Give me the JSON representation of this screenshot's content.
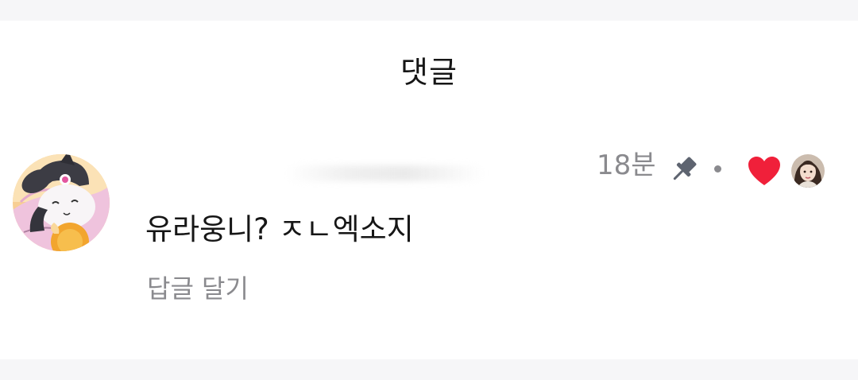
{
  "header": {
    "title": "댓글"
  },
  "comment": {
    "avatar_icon": "kuromi-avatar",
    "text": "유라웅니? ㅈㄴ엑소지",
    "time": "18분",
    "reply_label": "답글 달기",
    "pinned_icon": "pin-icon",
    "liked_icon": "heart-icon",
    "liked_by_author_icon": "author-avatar",
    "heart_color": "#f0203a"
  }
}
